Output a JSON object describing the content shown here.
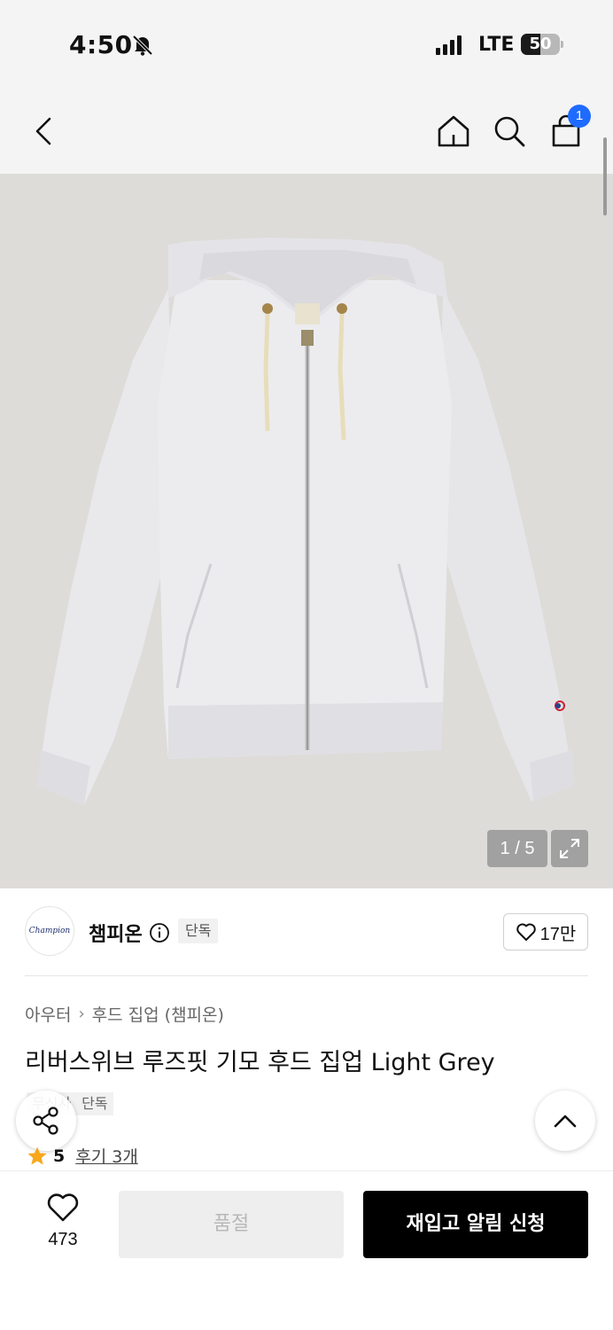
{
  "status_bar": {
    "time": "4:50",
    "network": "LTE",
    "battery": "50",
    "battery_level": 0.5
  },
  "nav": {
    "cart_badge": "1"
  },
  "gallery": {
    "counter": "1 / 5",
    "background_color": "#dedcd9"
  },
  "brand": {
    "name": "챔피온",
    "logo_text": "Champion",
    "exclusive_tag": "단독",
    "like_count": "17만"
  },
  "product": {
    "breadcrumb": [
      "아우터",
      "후드 집업 (챔피온)"
    ],
    "breadcrumb_separator": "›",
    "title": "리버스위브 루즈핏 기모 후드 집업 Light Grey",
    "tags": [
      "무신사",
      "단독"
    ],
    "rating": "5",
    "review_link": "후기 3개"
  },
  "bottom_bar": {
    "wish_count": "473",
    "soldout_label": "품절",
    "restock_label": "재입고 알림 신청"
  },
  "colors": {
    "accent_blue": "#1f6bff",
    "star": "#f7a71c",
    "primary_button": "#000000"
  }
}
